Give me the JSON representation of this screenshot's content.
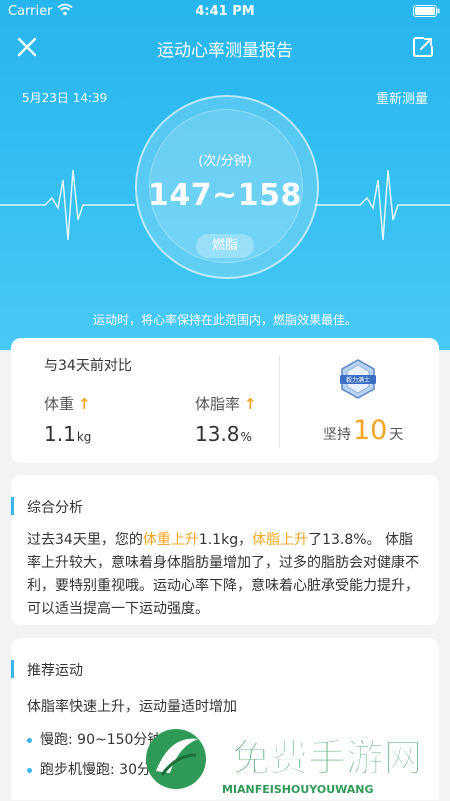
{
  "status_bar": {
    "carrier": "Carrier",
    "time": "4:41 PM"
  },
  "nav": {
    "title": "运动心率测量报告"
  },
  "report": {
    "date": "5月23日 14:39",
    "remeasure": "重新测量",
    "unit": "(次/分钟)",
    "range": "147~158",
    "zone": "燃脂",
    "hint": "运动时，将心率保持在此范围内，燃脂效果最佳。"
  },
  "comparison": {
    "title": "与34天前对比",
    "weight": {
      "label": "体重",
      "value": "1.1",
      "unit": "kg"
    },
    "body_fat": {
      "label": "体脂率",
      "value": "13.8",
      "unit": "%"
    },
    "badge_text": "毅力满士",
    "streak": {
      "prefix": "坚持",
      "days": "10",
      "suffix": "天"
    }
  },
  "analysis": {
    "title": "综合分析",
    "text_1": "过去34天里，您的",
    "hl_1": "体重上升",
    "text_2": "1.1kg，",
    "hl_2": "体脂上升",
    "text_3": "了13.8%。 体脂率上升较大，意味着身体脂肪量增加了，过多的脂肪会对健康不利，要特别重视哦。运动心率下降，意味着心脏承受能力提升，可以适当提高一下运动强度。"
  },
  "recommend": {
    "title": "推荐运动",
    "subtitle": "体脂率快速上升，运动量适时增加",
    "items": [
      "慢跑: 90~150分钟",
      "跑步机慢跑: 30分钟"
    ]
  },
  "watermark": {
    "text": "免费手游网",
    "url": "MIANFEISHOUYOUWANG"
  },
  "colors": {
    "primary": "#2cb8ef",
    "highlight": "#f5a623",
    "background": "#f1f3f5"
  }
}
